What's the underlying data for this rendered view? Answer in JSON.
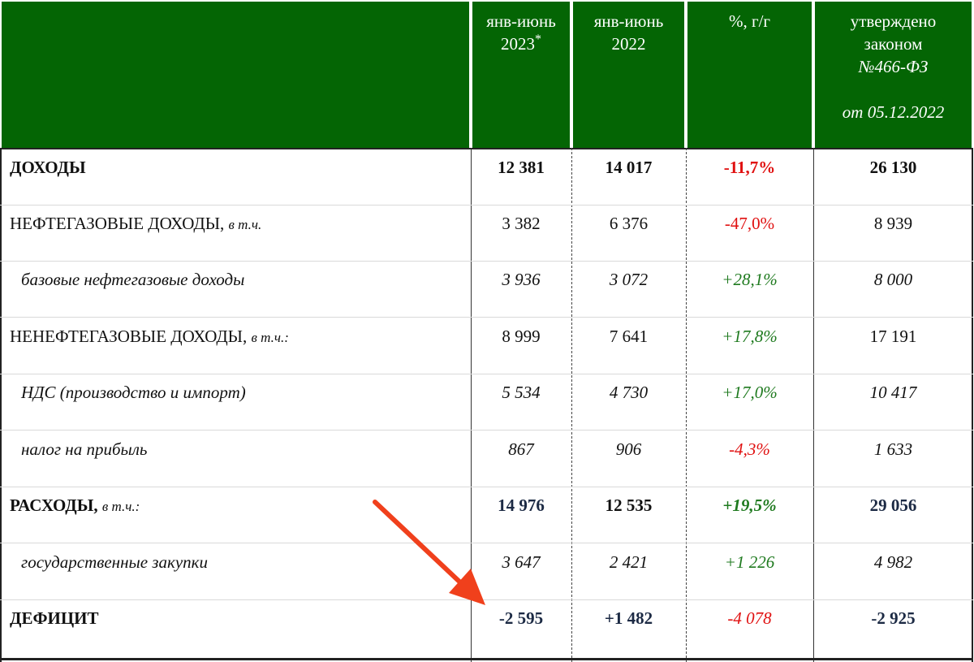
{
  "header": {
    "col1_line1": "янв-июнь",
    "col1_line2": "2023",
    "col1_mark": "*",
    "col2_line1": "янв-июнь",
    "col2_line2": "2022",
    "col3": "%, г/г",
    "col4_line1": "утверждено",
    "col4_line2": "законом",
    "col4_line3": "№466-ФЗ",
    "col4_line4": "от 05.12.2022"
  },
  "rows": [
    {
      "label": "ДОХОДЫ",
      "qualifier": "",
      "v2023": "12 381",
      "v2022": "14 017",
      "pct": "-11,7%",
      "law": "26 130"
    },
    {
      "label": "НЕФТЕГАЗОВЫЕ ДОХОДЫ,",
      "qualifier": "в т.ч.",
      "v2023": "3 382",
      "v2022": "6 376",
      "pct": "-47,0%",
      "law": "8 939"
    },
    {
      "label": "базовые нефтегазовые доходы",
      "qualifier": "",
      "v2023": "3 936",
      "v2022": "3 072",
      "pct": "+28,1%",
      "law": "8 000"
    },
    {
      "label": "НЕНЕФТЕГАЗОВЫЕ ДОХОДЫ,",
      "qualifier": "в т.ч.:",
      "v2023": "8 999",
      "v2022": "7 641",
      "pct": "+17,8%",
      "law": "17 191"
    },
    {
      "label": "НДС (производство и импорт)",
      "qualifier": "",
      "v2023": "5 534",
      "v2022": "4 730",
      "pct": "+17,0%",
      "law": "10 417"
    },
    {
      "label": "налог на прибыль",
      "qualifier": "",
      "v2023": "867",
      "v2022": "906",
      "pct": "-4,3%",
      "law": "1 633"
    },
    {
      "label": "РАСХОДЫ,",
      "qualifier": "в т.ч.:",
      "v2023": "14 976",
      "v2022": "12 535",
      "pct": "+19,5%",
      "law": "29 056"
    },
    {
      "label": "государственные закупки",
      "qualifier": "",
      "v2023": "3 647",
      "v2022": "2 421",
      "pct": "+1 226",
      "law": "4 982"
    },
    {
      "label": "ДЕФИЦИТ",
      "qualifier": "",
      "v2023": "-2 595",
      "v2022": "+1 482",
      "pct": "-4 078",
      "law": "-2 925"
    }
  ],
  "colors": {
    "header_bg": "#046504",
    "negative": "#e01010",
    "positive": "#1f7a1f",
    "arrow": "#f0401c"
  },
  "icons": {
    "annotation": "red-arrow-icon"
  }
}
